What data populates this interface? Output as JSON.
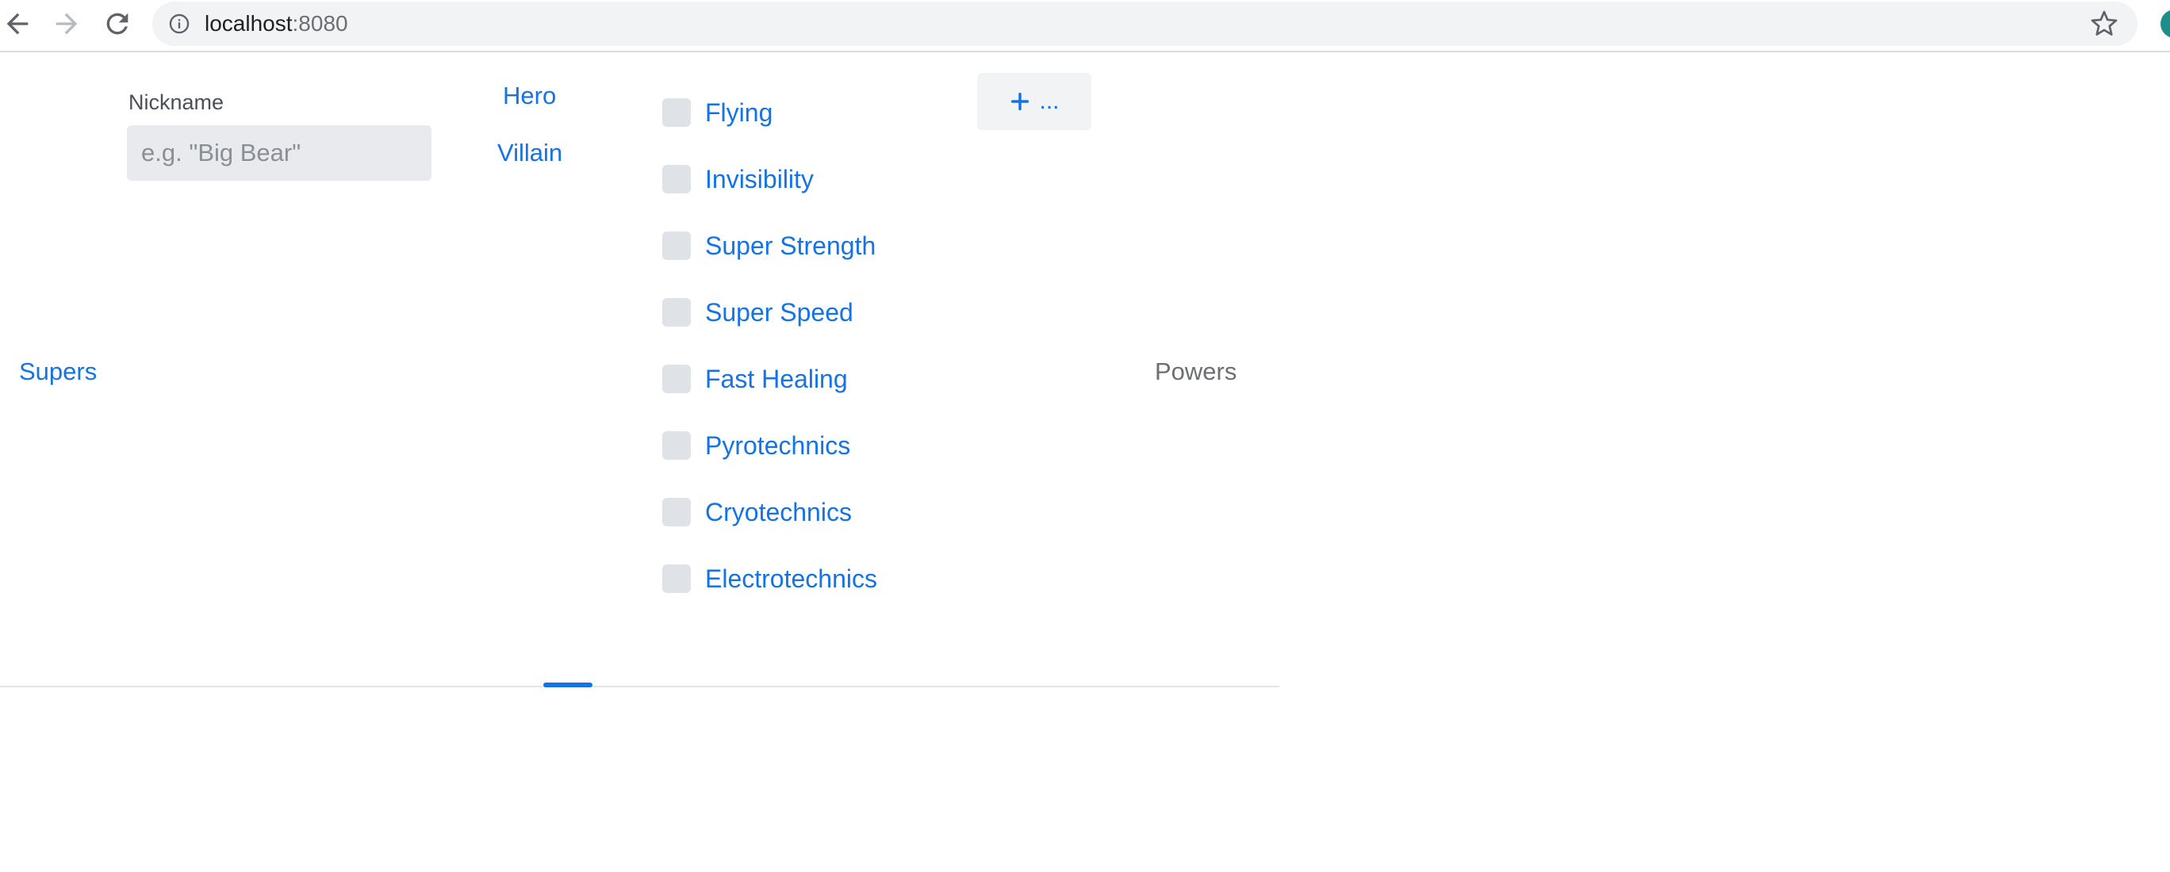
{
  "browser": {
    "url_host": "localhost",
    "url_port": ":8080"
  },
  "app": {
    "supers_tab": "Supers",
    "powers_heading": "Powers",
    "nickname": {
      "label": "Nickname",
      "value": "",
      "placeholder": "e.g. \"Big Bear\""
    },
    "type_options": [
      "Hero",
      "Villain"
    ],
    "powers": [
      {
        "label": "Flying",
        "checked": false
      },
      {
        "label": "Invisibility",
        "checked": false
      },
      {
        "label": "Super Strength",
        "checked": false
      },
      {
        "label": "Super Speed",
        "checked": false
      },
      {
        "label": "Fast Healing",
        "checked": false
      },
      {
        "label": "Pyrotechnics",
        "checked": false
      },
      {
        "label": "Cryotechnics",
        "checked": false
      },
      {
        "label": "Electrotechnics",
        "checked": false
      }
    ],
    "add_button": {
      "icon": "plus-icon",
      "label": "..."
    }
  },
  "colors": {
    "accent": "#1473e6",
    "muted_text": "#6b6f74",
    "checkbox_bg": "#dfe2e6"
  }
}
